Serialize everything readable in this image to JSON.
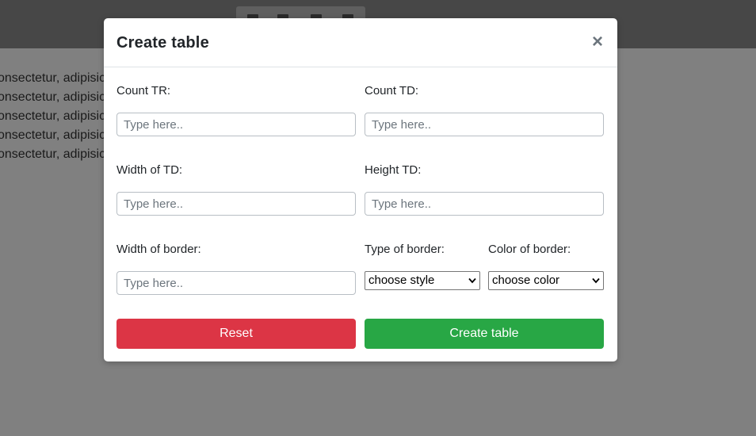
{
  "background_page": {
    "text_lines": [
      "onsectetur, adipisic",
      "onsectetur, adipisic",
      "onsectetur, adipisic",
      "onsectetur, adipisic",
      "onsectetur, adipisic"
    ]
  },
  "modal": {
    "title": "Create table",
    "close_symbol": "×",
    "fields": {
      "count_tr": {
        "label": "Count TR:",
        "placeholder": "Type here..",
        "value": ""
      },
      "count_td": {
        "label": "Count TD:",
        "placeholder": "Type here..",
        "value": ""
      },
      "width_td": {
        "label": "Width of TD:",
        "placeholder": "Type here..",
        "value": ""
      },
      "height_td": {
        "label": "Height TD:",
        "placeholder": "Type here..",
        "value": ""
      },
      "width_border": {
        "label": "Width of border:",
        "placeholder": "Type here..",
        "value": ""
      },
      "type_border": {
        "label": "Type of border:",
        "selected": "choose style"
      },
      "color_border": {
        "label": "Color of border:",
        "selected": "choose color"
      }
    },
    "buttons": {
      "reset_label": "Reset",
      "create_label": "Create table"
    }
  },
  "colors": {
    "overlay": "#808080",
    "topbar": "#474747",
    "reset_button": "#dc3545",
    "create_button": "#28a745",
    "text": "#212529",
    "close_icon": "#6c757d"
  },
  "icons": {
    "close": "close-icon",
    "select_arrow": "chevron-down-icon"
  }
}
